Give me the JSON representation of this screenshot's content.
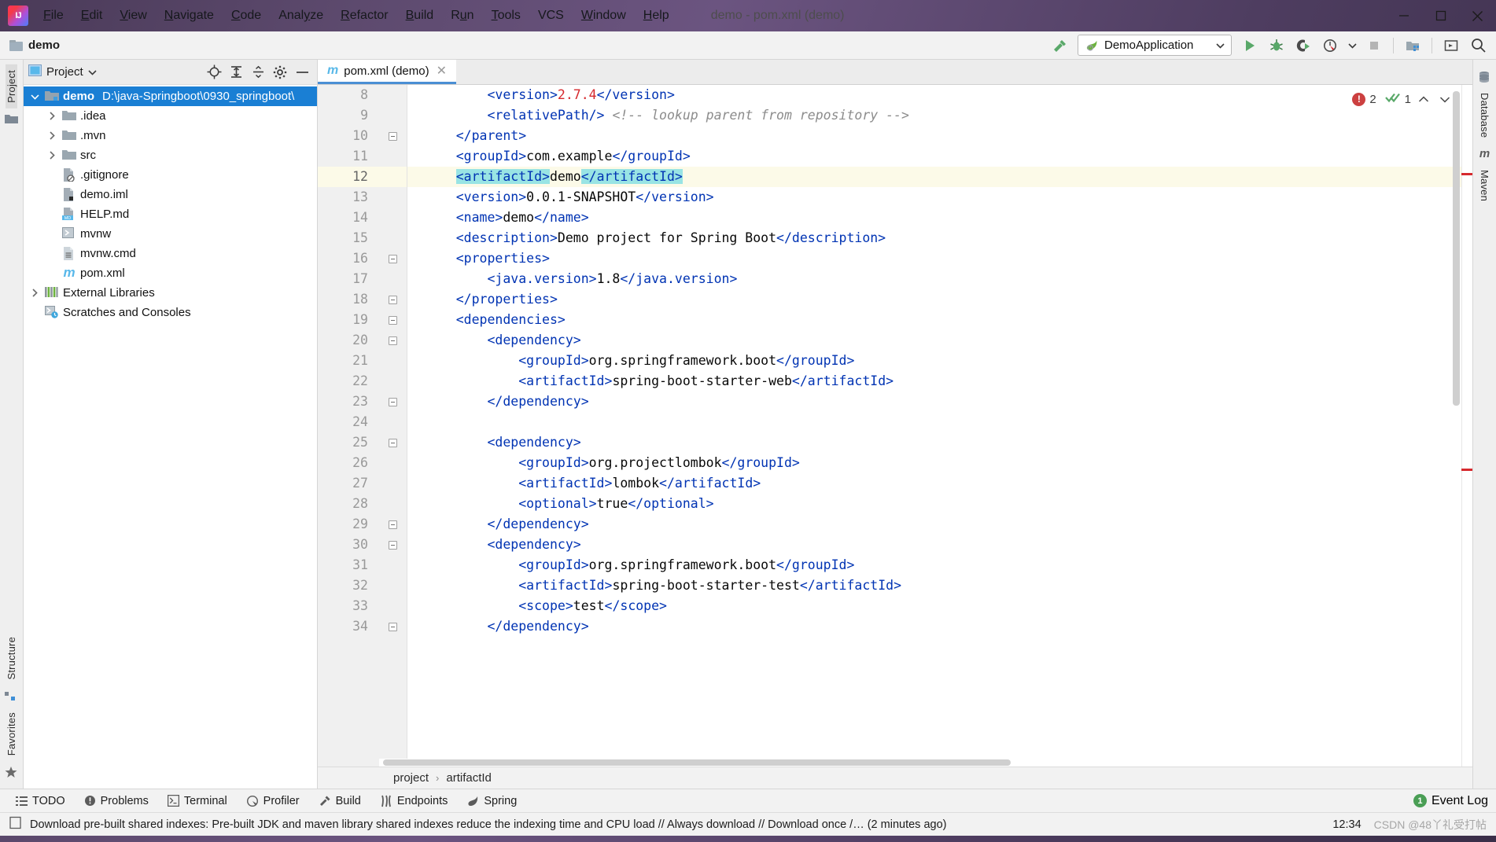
{
  "window": {
    "title": "demo - pom.xml (demo)",
    "logo_icon": "intellij-idea-logo",
    "minimize_icon": "minimize-icon",
    "maximize_icon": "maximize-icon",
    "close_icon": "close-icon"
  },
  "menu": [
    {
      "label": "File",
      "mnemonic": "F"
    },
    {
      "label": "Edit",
      "mnemonic": "E"
    },
    {
      "label": "View",
      "mnemonic": "V"
    },
    {
      "label": "Navigate",
      "mnemonic": "N"
    },
    {
      "label": "Code",
      "mnemonic": "C"
    },
    {
      "label": "Analyze",
      "mnemonic": "y"
    },
    {
      "label": "Refactor",
      "mnemonic": "R"
    },
    {
      "label": "Build",
      "mnemonic": "B"
    },
    {
      "label": "Run",
      "mnemonic": "u"
    },
    {
      "label": "Tools",
      "mnemonic": "T"
    },
    {
      "label": "VCS",
      "mnemonic": ""
    },
    {
      "label": "Window",
      "mnemonic": "W"
    },
    {
      "label": "Help",
      "mnemonic": "H"
    }
  ],
  "navbar": {
    "project_name": "demo",
    "folder_icon": "folder-icon",
    "build_icon": "build-hammer-icon",
    "run_config": {
      "label": "DemoApplication",
      "icon": "spring-boot-icon",
      "dropdown_icon": "chevron-down-icon"
    },
    "actions": [
      {
        "name": "run-button",
        "icon": "run-play-icon"
      },
      {
        "name": "debug-button",
        "icon": "debug-bug-icon"
      },
      {
        "name": "run-with-coverage-button",
        "icon": "coverage-icon"
      },
      {
        "name": "profiler-button",
        "icon": "profiler-icon"
      },
      {
        "name": "profiler-dropdown",
        "icon": "chevron-down-icon"
      },
      {
        "name": "stop-button",
        "icon": "stop-square-icon"
      },
      {
        "name": "project-structure-button",
        "icon": "project-structure-icon"
      },
      {
        "name": "hide-window-button",
        "icon": "window-icon"
      },
      {
        "name": "search-everywhere-button",
        "icon": "search-icon"
      }
    ]
  },
  "left_strip": {
    "tabs": [
      {
        "label": "Project",
        "selected": true
      },
      {
        "label": "Structure",
        "selected": false
      },
      {
        "label": "Favorites",
        "selected": false
      }
    ],
    "icons": [
      "folder-icon",
      "structure-icon",
      "star-icon"
    ]
  },
  "right_strip": {
    "tabs": [
      {
        "label": "Database",
        "icon": "database-icon"
      },
      {
        "label": "Maven",
        "icon": "maven-m-icon"
      }
    ]
  },
  "project_panel": {
    "title": "Project",
    "title_dropdown_icon": "chevron-down-icon",
    "toolbar": [
      {
        "name": "select-opened-file-button",
        "icon": "locate-target-icon"
      },
      {
        "name": "expand-all-button",
        "icon": "expand-all-icon"
      },
      {
        "name": "collapse-all-button",
        "icon": "collapse-all-icon"
      },
      {
        "name": "settings-button",
        "icon": "gear-icon"
      },
      {
        "name": "hide-button",
        "icon": "minimize-icon"
      }
    ],
    "tree": [
      {
        "label": "demo",
        "path": "D:\\java-Springboot\\0930_springboot\\",
        "indent": 0,
        "arrow": "expanded",
        "icon": "module-folder-icon",
        "selected": true,
        "bold": true
      },
      {
        "label": ".idea",
        "path": "",
        "indent": 1,
        "arrow": "collapsed",
        "icon": "folder-icon",
        "selected": false,
        "bold": false
      },
      {
        "label": ".mvn",
        "path": "",
        "indent": 1,
        "arrow": "collapsed",
        "icon": "folder-icon",
        "selected": false,
        "bold": false
      },
      {
        "label": "src",
        "path": "",
        "indent": 1,
        "arrow": "collapsed",
        "icon": "folder-icon",
        "selected": false,
        "bold": false
      },
      {
        "label": ".gitignore",
        "path": "",
        "indent": 1,
        "arrow": "none",
        "icon": "gitignore-file-icon",
        "selected": false,
        "bold": false
      },
      {
        "label": "demo.iml",
        "path": "",
        "indent": 1,
        "arrow": "none",
        "icon": "iml-file-icon",
        "selected": false,
        "bold": false
      },
      {
        "label": "HELP.md",
        "path": "",
        "indent": 1,
        "arrow": "none",
        "icon": "markdown-file-icon",
        "selected": false,
        "bold": false
      },
      {
        "label": "mvnw",
        "path": "",
        "indent": 1,
        "arrow": "none",
        "icon": "shell-script-icon",
        "selected": false,
        "bold": false
      },
      {
        "label": "mvnw.cmd",
        "path": "",
        "indent": 1,
        "arrow": "none",
        "icon": "cmd-file-icon",
        "selected": false,
        "bold": false
      },
      {
        "label": "pom.xml",
        "path": "",
        "indent": 1,
        "arrow": "none",
        "icon": "maven-m-icon",
        "selected": false,
        "bold": false
      },
      {
        "label": "External Libraries",
        "path": "",
        "indent": 0,
        "arrow": "collapsed",
        "icon": "libraries-icon",
        "selected": false,
        "bold": false
      },
      {
        "label": "Scratches and Consoles",
        "path": "",
        "indent": 0,
        "arrow": "none",
        "icon": "scratches-icon",
        "selected": false,
        "bold": false
      }
    ]
  },
  "editor": {
    "tab": {
      "label": "pom.xml (demo)",
      "icon": "maven-m-icon",
      "close_icon": "close-icon"
    },
    "inspections": {
      "error_count": "2",
      "error_icon": "error-circle-icon",
      "ok_count": "1",
      "ok_icon": "green-double-check-icon",
      "prev_icon": "chevron-up-icon",
      "next_icon": "chevron-down-icon"
    },
    "caret_line": 12,
    "first_line": 8,
    "lines": [
      {
        "no": "8",
        "fold": "none",
        "indent": 2,
        "parts": [
          {
            "t": "tag",
            "v": "<version>"
          },
          {
            "t": "num",
            "v": "2.7.4"
          },
          {
            "t": "tag",
            "v": "</version>"
          }
        ]
      },
      {
        "no": "9",
        "fold": "none",
        "indent": 2,
        "parts": [
          {
            "t": "tag",
            "v": "<relativePath/>"
          },
          {
            "t": "plain",
            "v": " "
          },
          {
            "t": "cmt",
            "v": "<!-- lookup parent from repository -->"
          }
        ]
      },
      {
        "no": "10",
        "fold": "minus",
        "indent": 1,
        "parts": [
          {
            "t": "tag",
            "v": "</parent>"
          }
        ]
      },
      {
        "no": "11",
        "fold": "none",
        "indent": 1,
        "parts": [
          {
            "t": "tag",
            "v": "<groupId>"
          },
          {
            "t": "plain",
            "v": "com.example"
          },
          {
            "t": "tag",
            "v": "</groupId>"
          }
        ]
      },
      {
        "no": "12",
        "fold": "none",
        "indent": 1,
        "parts": [
          {
            "t": "hl-tag",
            "v": "<artifactId>"
          },
          {
            "t": "plain",
            "v": "demo"
          },
          {
            "t": "hl-tag",
            "v": "</artifactId>"
          }
        ]
      },
      {
        "no": "13",
        "fold": "none",
        "indent": 1,
        "parts": [
          {
            "t": "tag",
            "v": "<version>"
          },
          {
            "t": "plain",
            "v": "0.0.1-SNAPSHOT"
          },
          {
            "t": "tag",
            "v": "</version>"
          }
        ]
      },
      {
        "no": "14",
        "fold": "none",
        "indent": 1,
        "parts": [
          {
            "t": "tag",
            "v": "<name>"
          },
          {
            "t": "plain",
            "v": "demo"
          },
          {
            "t": "tag",
            "v": "</name>"
          }
        ]
      },
      {
        "no": "15",
        "fold": "none",
        "indent": 1,
        "parts": [
          {
            "t": "tag",
            "v": "<description>"
          },
          {
            "t": "plain",
            "v": "Demo project for Spring Boot"
          },
          {
            "t": "tag",
            "v": "</description>"
          }
        ]
      },
      {
        "no": "16",
        "fold": "minus",
        "indent": 1,
        "parts": [
          {
            "t": "tag",
            "v": "<properties>"
          }
        ]
      },
      {
        "no": "17",
        "fold": "none",
        "indent": 2,
        "parts": [
          {
            "t": "tag",
            "v": "<java.version>"
          },
          {
            "t": "plain",
            "v": "1.8"
          },
          {
            "t": "tag",
            "v": "</java.version>"
          }
        ]
      },
      {
        "no": "18",
        "fold": "minus",
        "indent": 1,
        "parts": [
          {
            "t": "tag",
            "v": "</properties>"
          }
        ]
      },
      {
        "no": "19",
        "fold": "minus",
        "indent": 1,
        "parts": [
          {
            "t": "tag",
            "v": "<dependencies>"
          }
        ]
      },
      {
        "no": "20",
        "fold": "minus",
        "indent": 2,
        "parts": [
          {
            "t": "tag",
            "v": "<dependency>"
          }
        ]
      },
      {
        "no": "21",
        "fold": "none",
        "indent": 3,
        "parts": [
          {
            "t": "tag",
            "v": "<groupId>"
          },
          {
            "t": "plain",
            "v": "org.springframework.boot"
          },
          {
            "t": "tag",
            "v": "</groupId>"
          }
        ]
      },
      {
        "no": "22",
        "fold": "none",
        "indent": 3,
        "parts": [
          {
            "t": "tag",
            "v": "<artifactId>"
          },
          {
            "t": "plain",
            "v": "spring-boot-starter-web"
          },
          {
            "t": "tag",
            "v": "</artifactId>"
          }
        ]
      },
      {
        "no": "23",
        "fold": "minus",
        "indent": 2,
        "parts": [
          {
            "t": "tag",
            "v": "</dependency>"
          }
        ]
      },
      {
        "no": "24",
        "fold": "none",
        "indent": 0,
        "parts": []
      },
      {
        "no": "25",
        "fold": "minus",
        "indent": 2,
        "parts": [
          {
            "t": "tag",
            "v": "<dependency>"
          }
        ]
      },
      {
        "no": "26",
        "fold": "none",
        "indent": 3,
        "parts": [
          {
            "t": "tag",
            "v": "<groupId>"
          },
          {
            "t": "plain",
            "v": "org.projectlombok"
          },
          {
            "t": "tag",
            "v": "</groupId>"
          }
        ]
      },
      {
        "no": "27",
        "fold": "none",
        "indent": 3,
        "parts": [
          {
            "t": "tag",
            "v": "<artifactId>"
          },
          {
            "t": "plain",
            "v": "lombok"
          },
          {
            "t": "tag",
            "v": "</artifactId>"
          }
        ]
      },
      {
        "no": "28",
        "fold": "none",
        "indent": 3,
        "parts": [
          {
            "t": "tag",
            "v": "<optional>"
          },
          {
            "t": "plain",
            "v": "true"
          },
          {
            "t": "tag",
            "v": "</optional>"
          }
        ]
      },
      {
        "no": "29",
        "fold": "minus",
        "indent": 2,
        "parts": [
          {
            "t": "tag",
            "v": "</dependency>"
          }
        ]
      },
      {
        "no": "30",
        "fold": "minus",
        "indent": 2,
        "parts": [
          {
            "t": "tag",
            "v": "<dependency>"
          }
        ]
      },
      {
        "no": "31",
        "fold": "none",
        "indent": 3,
        "parts": [
          {
            "t": "tag",
            "v": "<groupId>"
          },
          {
            "t": "plain",
            "v": "org.springframework.boot"
          },
          {
            "t": "tag",
            "v": "</groupId>"
          }
        ]
      },
      {
        "no": "32",
        "fold": "none",
        "indent": 3,
        "parts": [
          {
            "t": "tag",
            "v": "<artifactId>"
          },
          {
            "t": "plain",
            "v": "spring-boot-starter-test"
          },
          {
            "t": "tag",
            "v": "</artifactId>"
          }
        ]
      },
      {
        "no": "33",
        "fold": "none",
        "indent": 3,
        "parts": [
          {
            "t": "tag",
            "v": "<scope>"
          },
          {
            "t": "plain",
            "v": "test"
          },
          {
            "t": "tag",
            "v": "</scope>"
          }
        ]
      },
      {
        "no": "34",
        "fold": "minus",
        "indent": 2,
        "parts": [
          {
            "t": "tag",
            "v": "</dependency>"
          }
        ]
      }
    ]
  },
  "breadcrumb": {
    "items": [
      "project",
      "artifactId"
    ],
    "separator": "›"
  },
  "tool_windows": [
    {
      "label": "TODO",
      "icon": "todo-list-icon"
    },
    {
      "label": "Problems",
      "icon": "problems-icon"
    },
    {
      "label": "Terminal",
      "icon": "terminal-icon"
    },
    {
      "label": "Profiler",
      "icon": "profiler-icon"
    },
    {
      "label": "Build",
      "icon": "build-hammer-icon"
    },
    {
      "label": "Endpoints",
      "icon": "endpoints-icon"
    },
    {
      "label": "Spring",
      "icon": "spring-leaf-icon"
    }
  ],
  "event_log": {
    "label": "Event Log",
    "count": "1"
  },
  "status": {
    "icon": "notification-icon",
    "message": "Download pre-built shared indexes: Pre-built JDK and maven library shared indexes reduce the indexing time and CPU load // Always download // Download once /… (2 minutes ago)",
    "time": "12:34",
    "watermark": "CSDN @48丫礼受打帖"
  },
  "colors": {
    "selection_blue": "#1a7fd4",
    "xml_tag": "#0033b3",
    "xml_number": "#d6292d",
    "comment_gray": "#8c8c8c",
    "brace_match": "#99e4e4",
    "caret_line": "#fcfae8",
    "error_red": "#cc4040",
    "success_green": "#4a9e55"
  }
}
